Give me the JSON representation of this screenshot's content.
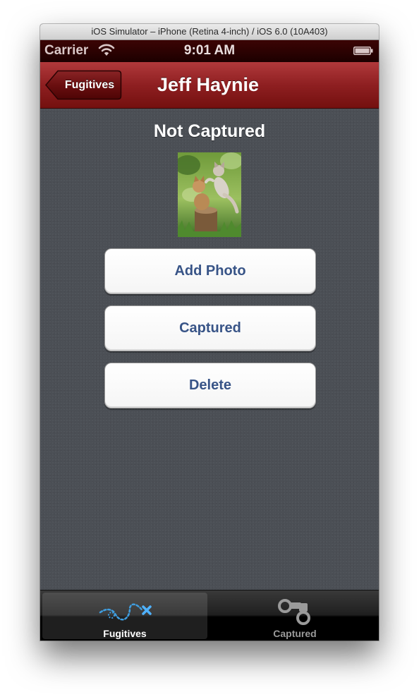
{
  "window": {
    "title": "iOS Simulator – iPhone (Retina 4-inch) / iOS 6.0 (10A403)"
  },
  "status_bar": {
    "carrier": "Carrier",
    "time": "9:01 AM",
    "icons": [
      "wifi-icon",
      "battery-icon"
    ]
  },
  "nav_bar": {
    "back_label": "Fugitives",
    "title": "Jeff Haynie",
    "color": "#8e1f21"
  },
  "detail": {
    "status": "Not Captured",
    "photo_alt": "kittens-photo",
    "buttons": {
      "add_photo": "Add Photo",
      "captured": "Captured",
      "delete": "Delete"
    },
    "button_text_color": "#385487"
  },
  "tab_bar": {
    "tabs": [
      {
        "label": "Fugitives",
        "icon": "dotted-path-icon",
        "selected": true
      },
      {
        "label": "Captured",
        "icon": "handcuffs-icon",
        "selected": false
      }
    ]
  }
}
